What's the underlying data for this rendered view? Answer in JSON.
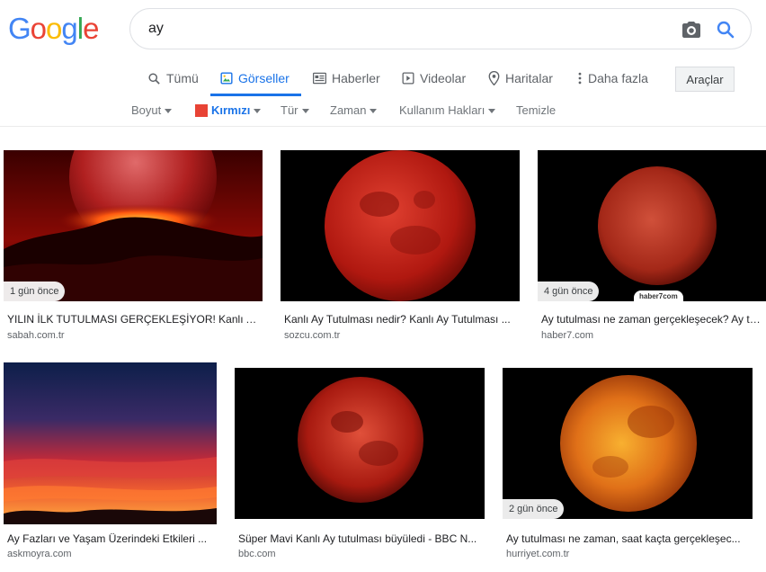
{
  "logo": {
    "letters": [
      "G",
      "o",
      "o",
      "g",
      "l",
      "e"
    ],
    "colors": [
      "#4285f4",
      "#ea4335",
      "#fbbc05",
      "#4285f4",
      "#34a853",
      "#ea4335"
    ]
  },
  "search": {
    "value": "ay",
    "camera_icon": "camera-icon",
    "search_icon": "search-icon"
  },
  "tabs": [
    {
      "label": "Tümü",
      "icon": "search-icon"
    },
    {
      "label": "Görseller",
      "icon": "image-icon",
      "active": true
    },
    {
      "label": "Haberler",
      "icon": "newspaper-icon"
    },
    {
      "label": "Videolar",
      "icon": "play-icon"
    },
    {
      "label": "Haritalar",
      "icon": "map-pin-icon"
    },
    {
      "label": "Daha fazla",
      "icon": "more-vert-icon"
    }
  ],
  "tools_label": "Araçlar",
  "filters": [
    {
      "label": "Boyut"
    },
    {
      "label": "Kırmızı",
      "selected": true,
      "swatch": "#e84335"
    },
    {
      "label": "Tür"
    },
    {
      "label": "Zaman"
    },
    {
      "label": "Kullanım Hakları"
    },
    {
      "label": "Temizle"
    }
  ],
  "results": [
    {
      "title": "YILIN İLK TUTULMASI GERÇEKLEŞİYOR! Kanlı Ay ...",
      "source": "sabah.com.tr",
      "badge": "1 gün önce"
    },
    {
      "title": "Kanlı Ay Tutulması nedir? Kanlı Ay Tutulması ...",
      "source": "sozcu.com.tr",
      "badge": ""
    },
    {
      "title": "Ay tutulması ne zaman gerçekleşecek? Ay tut...",
      "source": "haber7.com",
      "badge": "4 gün önce",
      "watermark": "haber7com"
    },
    {
      "title": "Ay Fazları ve Yaşam Üzerindeki Etkileri ...",
      "source": "askmoyra.com",
      "badge": ""
    },
    {
      "title": "Süper Mavi Kanlı Ay tutulması büyüledi - BBC N...",
      "source": "bbc.com",
      "badge": ""
    },
    {
      "title": "Ay tutulması ne zaman, saat kaçta gerçekleşec...",
      "source": "hurriyet.com.tr",
      "badge": "2 gün önce"
    }
  ]
}
